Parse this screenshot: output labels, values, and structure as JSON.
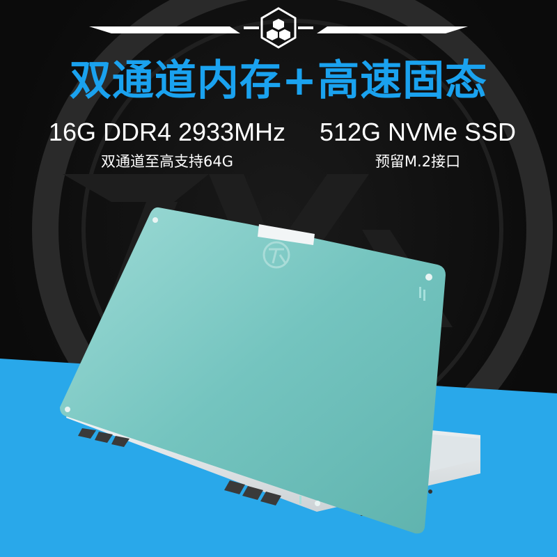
{
  "banner": {
    "title": "双通道内存+高速固态",
    "memory": {
      "spec": "16G DDR4 2933MHz",
      "note": "双通道至高支持64G"
    },
    "storage": {
      "spec": "512G NVMe SSD",
      "note": "预留M.2接口"
    }
  },
  "colors": {
    "title_blue": "#1aa2ef",
    "stripe_blue": "#29a8ea",
    "lid_teal": "#72c2bd",
    "chassis_white": "#e8ecee",
    "keyboard_glow": "#6fe6f0"
  },
  "icons": {
    "top_badge": "hexagon-cluster-icon",
    "lid_logo": "tuf-logo-icon"
  }
}
